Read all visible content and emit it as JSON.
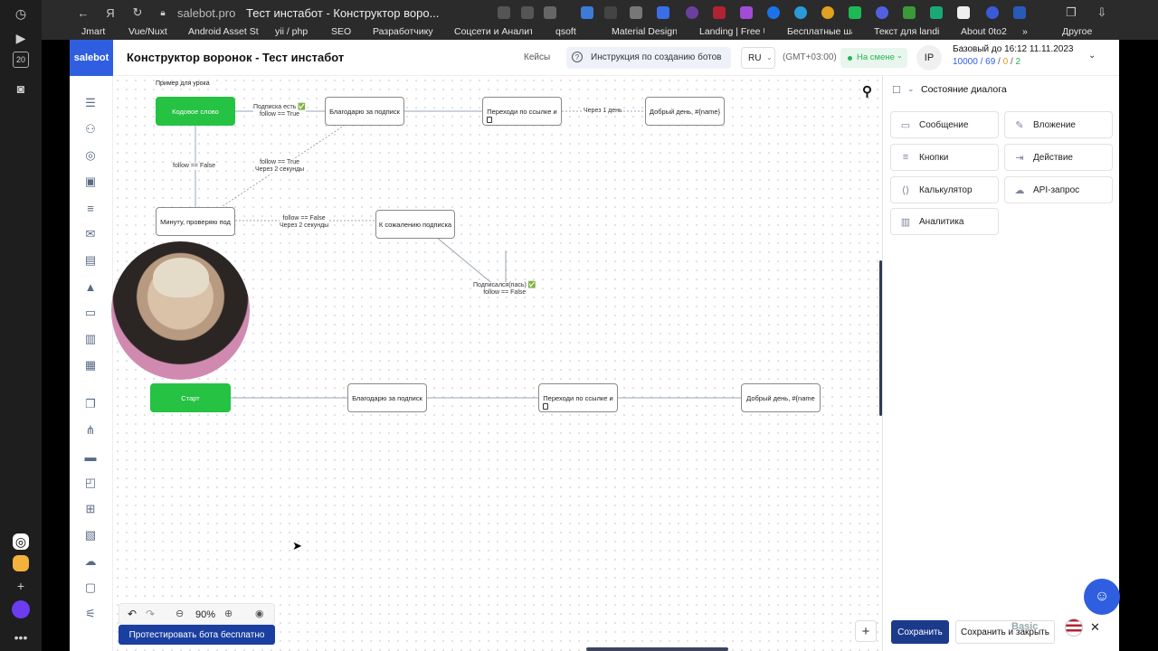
{
  "browser": {
    "url": "salebot.pro",
    "tab_title": "Тест инстабот - Конструктор воро...",
    "bookmarks": [
      "Jmart",
      "Vue/Nuxt",
      "Android Asset St",
      "yii / php",
      "SEO",
      "Разработчику",
      "Соцсети и Аналити",
      "qsoft",
      "Material Design C",
      "Landing | Free UI",
      "Бесплатные шаб",
      "Текст для landing",
      "About 0to2",
      "Другое"
    ],
    "more_glyph": "»"
  },
  "os_strip": {
    "clock_badge": "20"
  },
  "app": {
    "logo": "salebot",
    "page_title": "Конструктор воронок - Тест инстабот",
    "cases_link": "Кейсы",
    "instruction_button": "Инструкция по созданию ботов",
    "language": "RU",
    "timezone": "(GMT+03:00)",
    "shift_status": "На смене",
    "avatar_initials": "IP",
    "plan": {
      "label": "Базовый до 16:12 11.11.2023",
      "stat_1": "10000",
      "sep_1": " / ",
      "stat_2": "69",
      "sep_2": " / ",
      "stat_3": "0",
      "sep_3": " / ",
      "stat_4": "2"
    }
  },
  "canvas": {
    "lesson_label": "Пример для урока",
    "nodes": [
      {
        "id": "kw",
        "text": "Кодовое слово"
      },
      {
        "id": "thanks1",
        "text": "Благодарю за подписк"
      },
      {
        "id": "link1",
        "text": "Переходи по ссылке и"
      },
      {
        "id": "gday1",
        "text": "Добрый день, #{name}"
      },
      {
        "id": "minute",
        "text": "Минуту, проверяю под"
      },
      {
        "id": "sorry",
        "text": "К сожалению подписка"
      },
      {
        "id": "start",
        "text": "Старт"
      },
      {
        "id": "thanks2",
        "text": "Благодарю за подписк"
      },
      {
        "id": "link2",
        "text": "Переходи по ссылке и"
      },
      {
        "id": "gday2",
        "text": "Добрый день,  #{name"
      }
    ],
    "edge_labels": {
      "sub_yes_1": "Подписка есть ✅",
      "sub_yes_2": "follow == True",
      "after_1day": "Через 1 день",
      "follow_false": "follow == False",
      "true_delay_1": "follow == True",
      "true_delay_2": "Через 2 секунды",
      "false_delay_1": "follow == False",
      "false_delay_2": "Через 2 секунды",
      "subscribed_1": "Подписался(пась) ✅",
      "subscribed_2": "follow == False"
    },
    "zoom": "90%",
    "test_button": "Протестировать бота бесплатно",
    "add_button": "+"
  },
  "right_panel": {
    "state_title": "Состояние диалога",
    "blocks": [
      {
        "label": "Сообщение",
        "icon": "message-icon"
      },
      {
        "label": "Вложение",
        "icon": "paperclip-icon"
      },
      {
        "label": "Кнопки",
        "icon": "buttons-icon"
      },
      {
        "label": "Действие",
        "icon": "action-icon"
      },
      {
        "label": "Калькулятор",
        "icon": "code-icon"
      },
      {
        "label": "API-запрос",
        "icon": "cloud-icon"
      },
      {
        "label": "Аналитика",
        "icon": "analytics-icon"
      }
    ],
    "save_button": "Сохранить",
    "save_close_button": "Сохранить и закрыть",
    "basic_label": "Basic"
  },
  "colors": {
    "brand": "#2f5fe0",
    "node_green": "#25c243",
    "primary_button": "#1c3a8c",
    "status_green": "#21b45a"
  }
}
